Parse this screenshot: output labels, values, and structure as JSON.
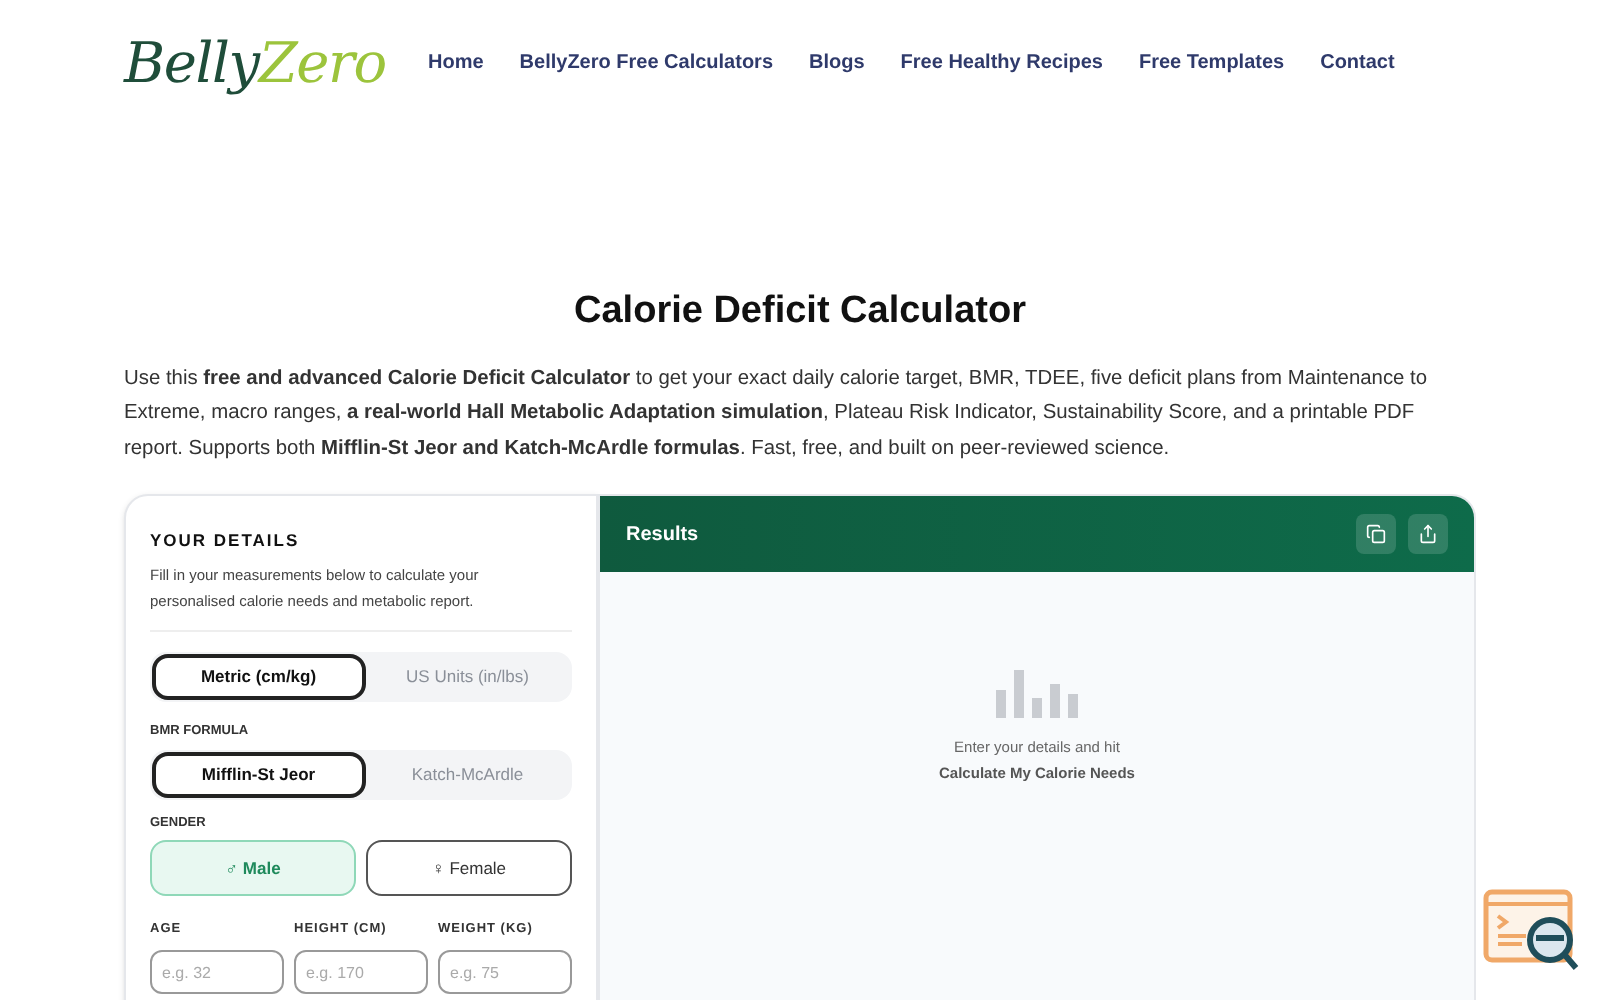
{
  "logo": {
    "first": "Belly",
    "second": "Zero"
  },
  "nav": [
    "Home",
    "BellyZero Free Calculators",
    "Blogs",
    "Free Healthy Recipes",
    "Free Templates",
    "Contact"
  ],
  "title": "Calorie Deficit Calculator",
  "intro": "Use this **free and advanced Calorie Deficit Calculator** to get your exact daily calorie target, BMR, TDEE, five deficit plans from Maintenance to Extreme, macro ranges, **a real-world Hall Metabolic Adaptation simulation**, Plateau Risk Indicator, Sustainability Score, and a printable PDF report. Supports both **Mifflin-St Jeor and Katch-McArdle formulas**. Fast, free, and built on peer-reviewed science.",
  "details": {
    "heading": "YOUR DETAILS",
    "description": "Fill in your measurements below to calculate your personalised calorie needs and metabolic report.",
    "units": [
      {
        "label": "Metric (cm/kg)",
        "selected": true
      },
      {
        "label": "US Units (in/lbs)",
        "selected": false
      }
    ],
    "formula_label": "BMR FORMULA",
    "formulas": [
      {
        "label": "Mifflin-St Jeor",
        "selected": true
      },
      {
        "label": "Katch-McArdle",
        "selected": false
      }
    ],
    "gender_label": "GENDER",
    "genders": [
      {
        "label": "♂ Male",
        "selected": true
      },
      {
        "label": "♀ Female",
        "selected": false
      }
    ],
    "fields": [
      {
        "label": "AGE",
        "placeholder": "e.g. 32"
      },
      {
        "label": "HEIGHT (CM)",
        "placeholder": "e.g. 170"
      },
      {
        "label": "WEIGHT (KG)",
        "placeholder": "e.g. 75"
      }
    ]
  },
  "results": {
    "title": "Results",
    "hint": "Enter your details and hit",
    "action": "Calculate My Calorie Needs"
  }
}
